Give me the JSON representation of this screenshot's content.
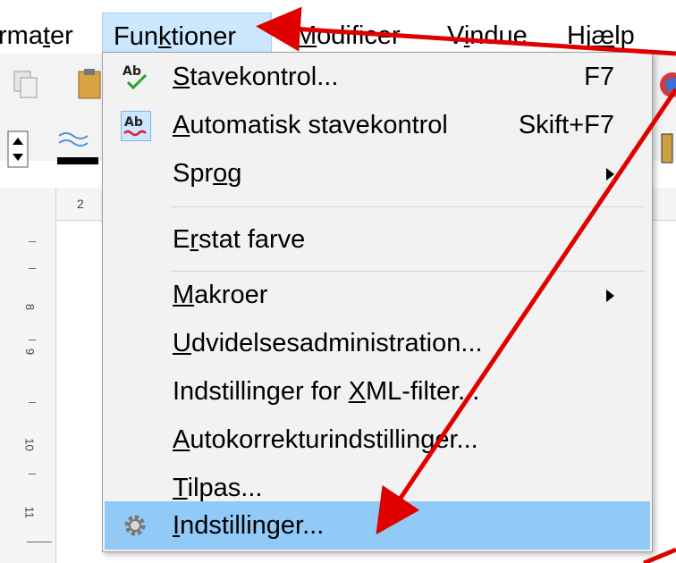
{
  "menubar": {
    "items": [
      {
        "pre": "rma",
        "ul": "t",
        "post": "er"
      },
      {
        "pre": "Fun",
        "ul": "k",
        "post": "tioner"
      },
      {
        "pre": "",
        "ul": "M",
        "post": "odificer"
      },
      {
        "pre": "V",
        "ul": "i",
        "post": "ndue"
      },
      {
        "pre": "Hj",
        "ul": "æ",
        "post": "lp"
      }
    ]
  },
  "ruler": {
    "top_number": "2",
    "left_numbers": [
      "8",
      "9",
      "10",
      "11"
    ]
  },
  "dropdown": {
    "items": [
      {
        "pre": "",
        "ul": "S",
        "post": "tavekontrol...",
        "shortcut": "F7",
        "icon": "spellcheck-icon"
      },
      {
        "pre": "",
        "ul": "A",
        "post": "utomatisk stavekontrol",
        "shortcut": "Skift+F7",
        "icon": "auto-spellcheck-icon"
      },
      {
        "pre": "Spr",
        "ul": "o",
        "post": "g",
        "submenu": true
      },
      {
        "pre": "E",
        "ul": "r",
        "post": "stat farve"
      },
      {
        "pre": "",
        "ul": "M",
        "post": "akroer",
        "submenu": true
      },
      {
        "pre": "",
        "ul": "U",
        "post": "dvidelsesadministration..."
      },
      {
        "pre": "Indstillinger for ",
        "ul": "X",
        "post": "ML-filter..."
      },
      {
        "pre": "",
        "ul": "A",
        "post": "utokorrekturindstillinger..."
      },
      {
        "pre": "",
        "ul": "T",
        "post": "ilpas..."
      },
      {
        "pre": "",
        "ul": "I",
        "post": "ndstillinger...",
        "icon": "gear-icon",
        "highlighted": true
      }
    ]
  },
  "colors": {
    "active_menu_bg": "#cce8ff",
    "highlight_bg": "#91c9f7",
    "annotation_arrow": "#e00000"
  }
}
